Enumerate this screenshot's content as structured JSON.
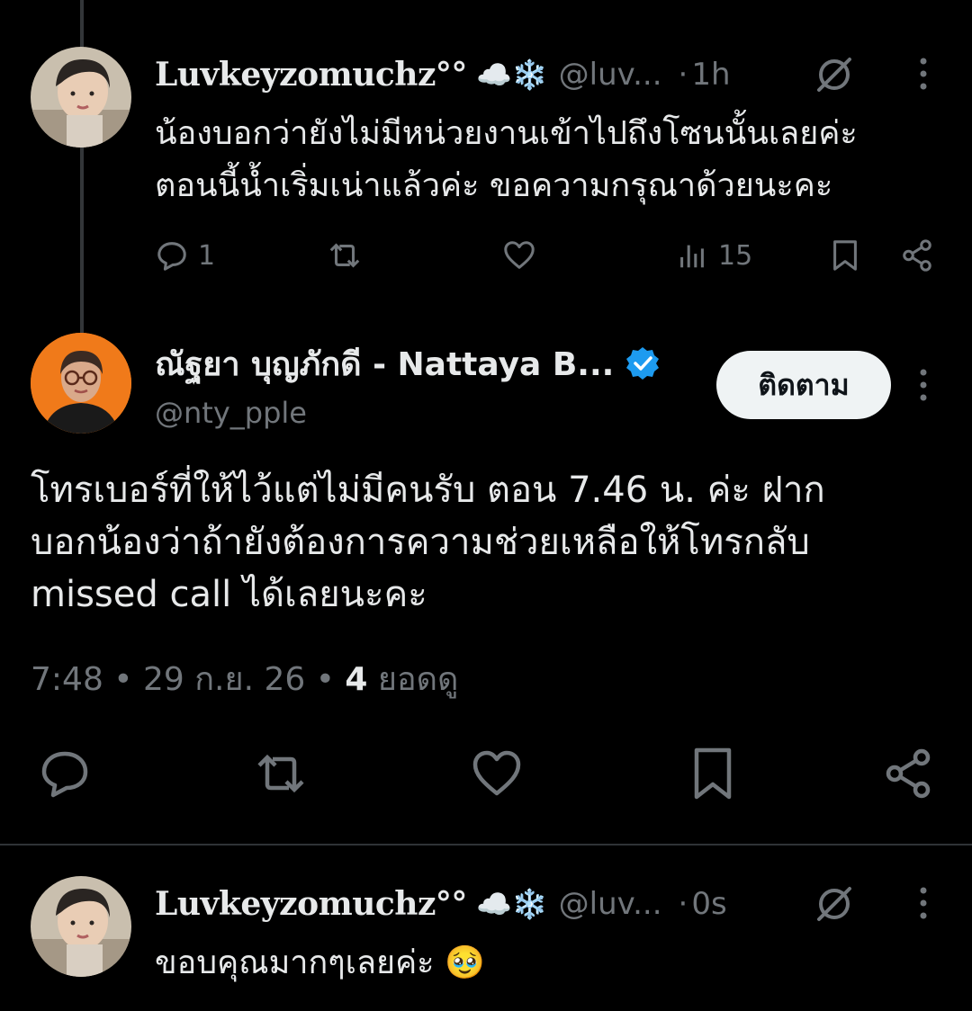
{
  "reply_1": {
    "display_name": "Luvkeyzomuchz°°",
    "name_emojis": "☁️❄️",
    "handle": "@luv...",
    "dot": "·",
    "time": "1h",
    "text_line1": "น้องบอกว่ายังไม่มีหน่วยงานเข้าไปถึงโซนนั้นเลยค่ะ",
    "text_line2": "ตอนนี้น้ำเริ่มเน่าแล้วค่ะ ขอความกรุณาด้วยนะคะ",
    "reply_count": "1",
    "view_count": "15"
  },
  "main_tweet": {
    "display_name": "ณัฐยา บุญภักดี - Nattaya B...",
    "handle": "@nty_pple",
    "follow_label": "ติดตาม",
    "text_line1": "โทรเบอร์ที่ให้ไว้แต่ไม่มีคนรับ ตอน 7.46 น. ค่ะ ฝาก",
    "text_line2": "บอกน้องว่าถ้ายังต้องการความช่วยเหลือให้โทรกลับ",
    "text_line3": "missed call ได้เลยนะคะ",
    "time": "7:48",
    "sep": "•",
    "date": "29 ก.ย. 26",
    "views_value": "4",
    "views_label": "ยอดดู"
  },
  "reply_2": {
    "display_name": "Luvkeyzomuchz°°",
    "name_emojis": "☁️❄️",
    "handle": "@luv...",
    "dot": "·",
    "time": "0s",
    "text": "ขอบคุณมากๆเลยค่ะ 🥹"
  },
  "colors": {
    "background": "#000000",
    "text": "#e7e9ea",
    "muted": "#71767b",
    "verified": "#1d9bf0",
    "follow_bg": "#eff3f4"
  },
  "icons": [
    "reply-icon",
    "repost-icon",
    "like-icon",
    "views-icon",
    "bookmark-icon",
    "share-icon",
    "grok-icon",
    "more-icon",
    "verified-icon"
  ]
}
